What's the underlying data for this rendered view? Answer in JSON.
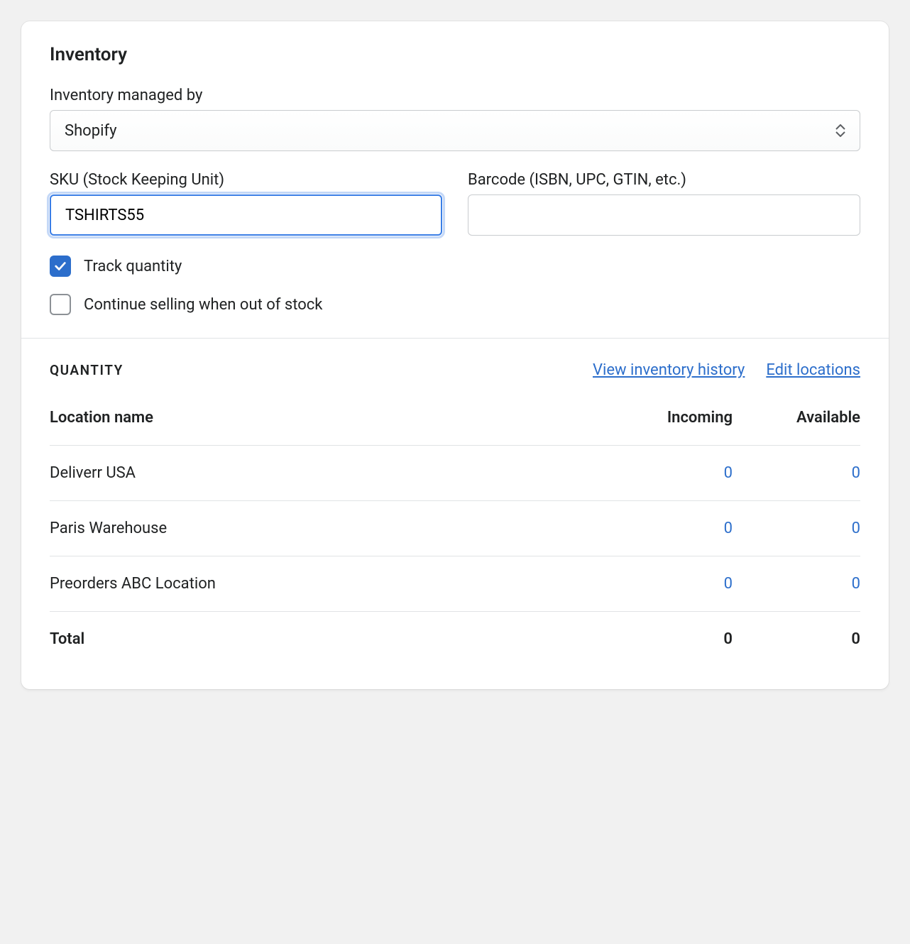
{
  "card": {
    "title": "Inventory",
    "managed_by_label": "Inventory managed by",
    "managed_by_value": "Shopify",
    "sku_label": "SKU (Stock Keeping Unit)",
    "sku_value": "TSHIRTS55",
    "barcode_label": "Barcode (ISBN, UPC, GTIN, etc.)",
    "barcode_value": "",
    "track_quantity_label": "Track quantity",
    "track_quantity_checked": true,
    "continue_selling_label": "Continue selling when out of stock",
    "continue_selling_checked": false
  },
  "quantity": {
    "title": "QUANTITY",
    "view_history_link": "View inventory history",
    "edit_locations_link": "Edit locations",
    "columns": {
      "location": "Location name",
      "incoming": "Incoming",
      "available": "Available"
    },
    "rows": [
      {
        "location": "Deliverr USA",
        "incoming": "0",
        "available": "0"
      },
      {
        "location": "Paris Warehouse",
        "incoming": "0",
        "available": "0"
      },
      {
        "location": "Preorders ABC Location",
        "incoming": "0",
        "available": "0"
      }
    ],
    "total_label": "Total",
    "total_incoming": "0",
    "total_available": "0"
  }
}
